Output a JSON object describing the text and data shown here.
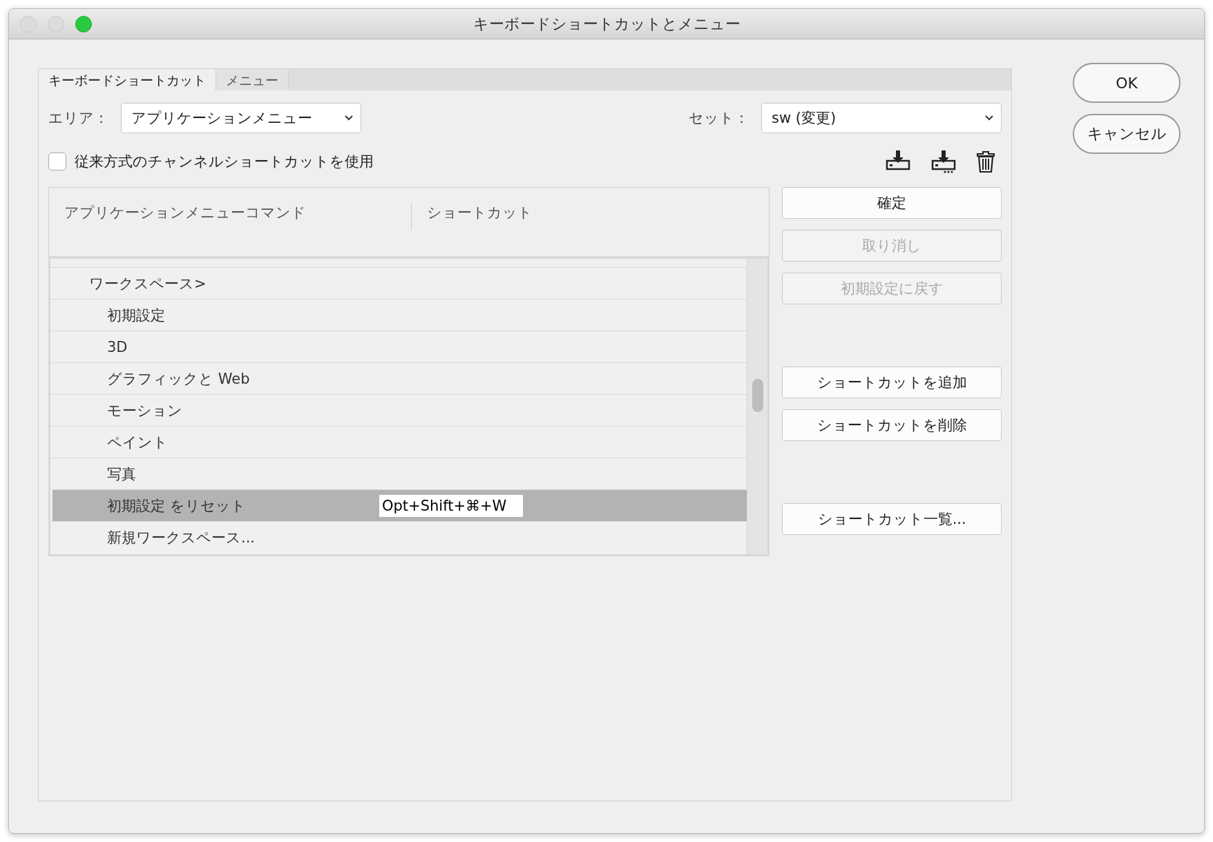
{
  "window": {
    "title": "キーボードショートカットとメニュー"
  },
  "tabs": [
    {
      "label": "キーボードショートカット",
      "selected": true
    },
    {
      "label": "メニュー",
      "selected": false
    }
  ],
  "area": {
    "label": "エリア：",
    "value": "アプリケーションメニュー"
  },
  "set": {
    "label": "セット：",
    "value": "sw (変更)"
  },
  "legacy_checkbox": {
    "label": "従来方式のチャンネルショートカットを使用",
    "checked": false
  },
  "table": {
    "columns": [
      "アプリケーションメニューコマンド",
      "ショートカット"
    ],
    "rows": [
      {
        "label": "ワークスペース>",
        "selected": false,
        "children": [
          {
            "label": "初期設定",
            "selected": false
          },
          {
            "label": "3D",
            "selected": false
          },
          {
            "label": "グラフィックと Web",
            "selected": false
          },
          {
            "label": "モーション",
            "selected": false
          },
          {
            "label": "ペイント",
            "selected": false
          },
          {
            "label": "写真",
            "selected": false
          },
          {
            "label": "初期設定 をリセット",
            "selected": true,
            "shortcut": "Opt+Shift+⌘+W"
          },
          {
            "label": "新規ワークスペース...",
            "selected": false
          }
        ]
      }
    ]
  },
  "side_button_groups": [
    [
      {
        "label": "確定",
        "disabled": false
      },
      {
        "label": "取り消し",
        "disabled": true
      },
      {
        "label": "初期設定に戻す",
        "disabled": true
      }
    ],
    [
      {
        "label": "ショートカットを追加",
        "disabled": false
      },
      {
        "label": "ショートカットを削除",
        "disabled": false
      }
    ],
    [
      {
        "label": "ショートカット一覧...",
        "disabled": false
      }
    ]
  ],
  "dialog_buttons": [
    {
      "label": "OK"
    },
    {
      "label": "キャンセル"
    }
  ]
}
